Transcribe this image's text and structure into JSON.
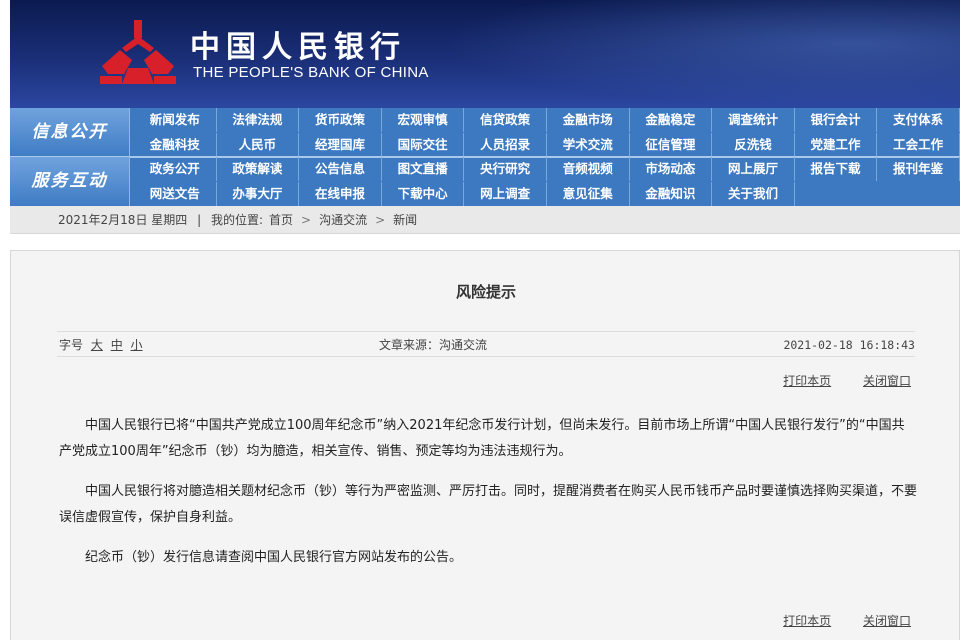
{
  "header": {
    "cn_title": "中国人民银行",
    "en_title": "THE PEOPLE'S BANK OF CHINA",
    "logo": "pboc-emblem-icon",
    "colors": {
      "banner": "#1b2f78",
      "nav": "#3d79c0",
      "emblem": "#d8202a"
    }
  },
  "nav": {
    "section1": {
      "label": "信息公开",
      "items": [
        "新闻发布",
        "法律法规",
        "货币政策",
        "宏观审慎",
        "信贷政策",
        "金融市场",
        "金融稳定",
        "调查统计",
        "银行会计",
        "支付体系",
        "金融科技",
        "人民币",
        "经理国库",
        "国际交往",
        "人员招录",
        "学术交流",
        "征信管理",
        "反洗钱",
        "党建工作",
        "工会工作"
      ]
    },
    "section2": {
      "label": "服务互动",
      "items": [
        "政务公开",
        "政策解读",
        "公告信息",
        "图文直播",
        "央行研究",
        "音频视频",
        "市场动态",
        "网上展厅",
        "报告下载",
        "报刊年鉴",
        "网送文告",
        "办事大厅",
        "在线申报",
        "下载中心",
        "网上调查",
        "意见征集",
        "金融知识",
        "关于我们"
      ]
    }
  },
  "breadcrumb": {
    "date": "2021年2月18日 星期四",
    "location_label": "我的位置:",
    "items": [
      "首页",
      "沟通交流",
      "新闻"
    ]
  },
  "article": {
    "title": "风险提示",
    "font_size_label": "字号",
    "font_sizes": [
      "大",
      "中",
      "小"
    ],
    "source": "文章来源：沟通交流",
    "datetime": "2021-02-18 16:18:43",
    "print_label": "打印本页",
    "close_label": "关闭窗口",
    "paragraphs": [
      "中国人民银行已将“中国共产党成立100周年纪念币”纳入2021年纪念币发行计划，但尚未发行。目前市场上所谓“中国人民银行发行”的“中国共产党成立100周年”纪念币（钞）均为臆造，相关宣传、销售、预定等均为违法违规行为。",
      "中国人民银行将对臆造相关题材纪念币（钞）等行为严密监测、严厉打击。同时，提醒消费者在购买人民币钱币产品时要谨慎选择购买渠道，不要误信虚假宣传，保护自身利益。",
      "纪念币（钞）发行信息请查阅中国人民银行官方网站发布的公告。"
    ]
  }
}
